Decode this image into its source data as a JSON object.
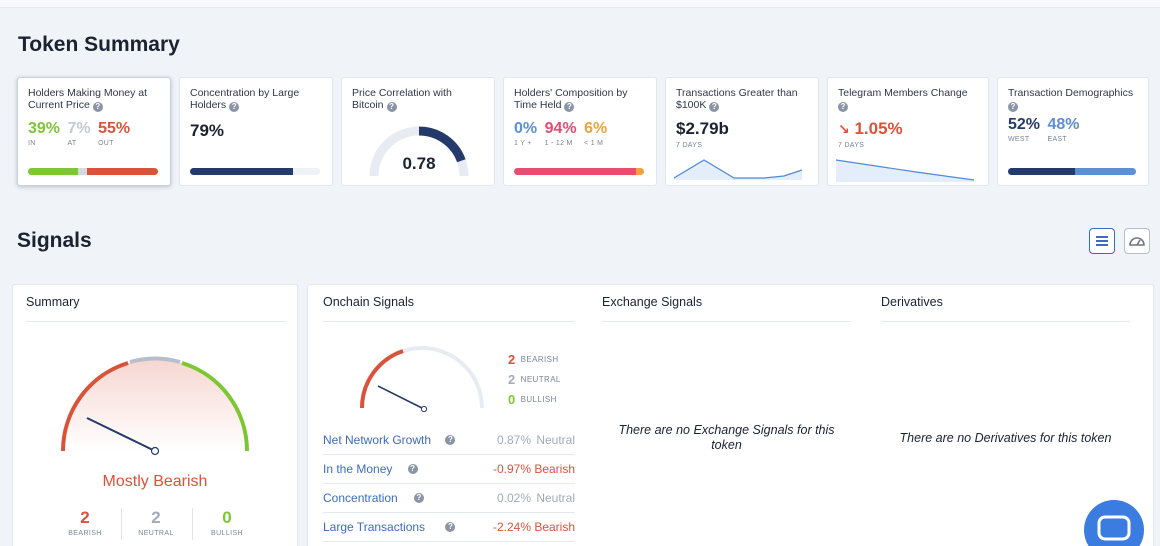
{
  "headings": {
    "token_summary": "Token Summary",
    "signals": "Signals"
  },
  "colors": {
    "green": "#7cc732",
    "red": "#d9533a",
    "gray": "#a3aab8",
    "blue": "#5b8fd6",
    "navy": "#243a6b",
    "pink": "#e84d6f",
    "orange": "#f0a23b"
  },
  "cards": {
    "holders_money": {
      "title": "Holders Making Money at Current Price",
      "in_value": "39%",
      "in_label": "IN",
      "at_value": "7%",
      "at_label": "AT",
      "out_value": "55%",
      "out_label": "OUT",
      "bar_fractions": [
        0.39,
        0.07,
        0.55
      ]
    },
    "concentration": {
      "title": "Concentration by Large Holders",
      "value": "79%",
      "bar_fraction": 0.79
    },
    "price_corr": {
      "title": "Price Correlation with Bitcoin",
      "value": "0.78",
      "gauge_fraction": 0.78
    },
    "composition": {
      "title": "Holders' Composition by Time Held",
      "v1": "0%",
      "l1": "1 Y +",
      "v2": "94%",
      "l2": "1 - 12 M",
      "v3": "6%",
      "l3": "< 1 M",
      "bar_fractions": [
        0.0,
        0.94,
        0.06
      ]
    },
    "transactions": {
      "title": "Transactions Greater than $100K",
      "value": "$2.79b",
      "period": "7 DAYS"
    },
    "telegram": {
      "title": "Telegram Members Change",
      "value": "1.05%",
      "period": "7 DAYS"
    },
    "demographics": {
      "title": "Transaction Demographics",
      "west_value": "52%",
      "west_label": "WEST",
      "east_value": "48%",
      "east_label": "EAST",
      "bar_fractions": [
        0.52,
        0.48
      ]
    }
  },
  "summary": {
    "title": "Summary",
    "verdict": "Mostly Bearish",
    "bearish_count": "2",
    "bearish_label": "BEARISH",
    "neutral_count": "2",
    "neutral_label": "NEUTRAL",
    "bullish_count": "0",
    "bullish_label": "BULLISH"
  },
  "onchain": {
    "title": "Onchain Signals",
    "bearish_count": "2",
    "bearish_label": "BEARISH",
    "neutral_count": "2",
    "neutral_label": "NEUTRAL",
    "bullish_count": "0",
    "bullish_label": "BULLISH",
    "rows": [
      {
        "label": "Net Network Growth",
        "pct": "0.87%",
        "status": "Neutral"
      },
      {
        "label": "In the Money",
        "pct": "-0.97%",
        "status": "Bearish"
      },
      {
        "label": "Concentration",
        "pct": "0.02%",
        "status": "Neutral"
      },
      {
        "label": "Large Transactions",
        "pct": "-2.24%",
        "status": "Bearish"
      }
    ]
  },
  "exchange": {
    "title": "Exchange Signals",
    "empty": "There are no Exchange Signals for this token"
  },
  "derivatives": {
    "title": "Derivatives",
    "empty": "There are no Derivatives for this token"
  },
  "icons": {
    "list_view": "list-icon",
    "gauge_view": "gauge-icon",
    "chat": "chat-icon",
    "help": "help-icon",
    "down_arrow": "arrow-down-right-icon"
  }
}
